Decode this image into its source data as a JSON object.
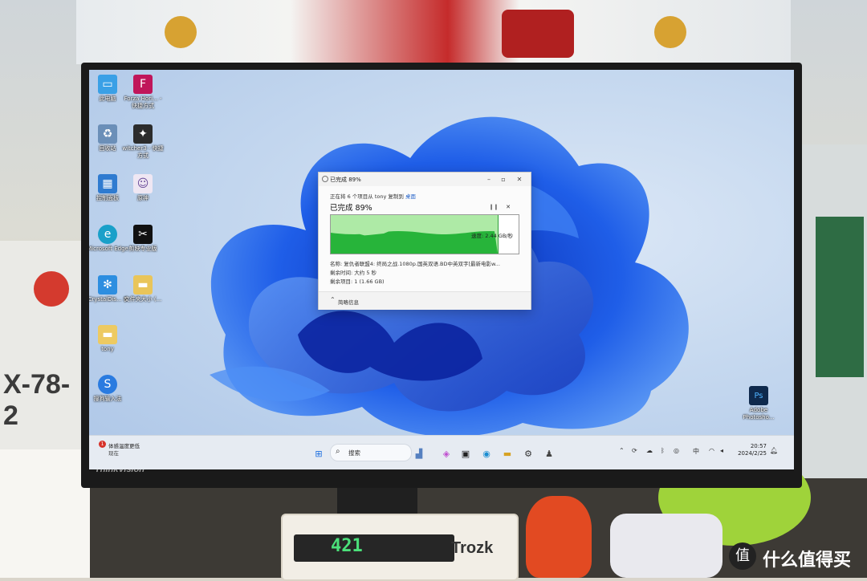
{
  "photo": {
    "gundam_code": "X-78-2",
    "monitor_brand": "ThinkVision",
    "device_brand": "Trozk",
    "device_display": "421",
    "watermark": "值 什么值得买"
  },
  "desktop_icons": [
    {
      "label": "此电脑",
      "icon": "monitor-icon"
    },
    {
      "label": "Forza Hori... - 快捷方式",
      "icon": "forza-icon"
    },
    {
      "label": "回收站",
      "icon": "recycle-bin-icon"
    },
    {
      "label": "witcher3 - 快捷方式",
      "icon": "witcher-icon"
    },
    {
      "label": "控制面板",
      "icon": "control-panel-icon"
    },
    {
      "label": "原神",
      "icon": "genshin-icon"
    },
    {
      "label": "Microsoft Edge",
      "icon": "edge-icon"
    },
    {
      "label": "剪映专业版",
      "icon": "capcut-icon"
    },
    {
      "label": "CrystalDis... 8",
      "icon": "crystaldisk-icon"
    },
    {
      "label": "文件夹大小 (...",
      "icon": "folder-icon"
    },
    {
      "label": "tony",
      "icon": "user-folder-icon"
    },
    {
      "label": "搜狗输入法",
      "icon": "sogou-icon"
    },
    {
      "label": "Adobe Photosho...",
      "icon": "photoshop-icon"
    }
  ],
  "dialog": {
    "title": "已完成 89%",
    "subtitle_prefix": "正在将 6 个项目从 tony 复制到",
    "subtitle_link": "桌面",
    "progress_label": "已完成 89%",
    "progress_fraction": 0.89,
    "speed": "速度: 2.44 GB/秒",
    "name_line": "名称: 复仇者联盟4: 终局之战.1080p.国英双语.BD中英双字[最新电影w...",
    "time_line": "剩余时间: 大约 5 秒",
    "items_line": "剩余项目: 1 (1.66 GB)",
    "details_label": "简略信息",
    "pause_icon": "pause-icon",
    "cancel_icon": "close-icon"
  },
  "taskbar": {
    "weather_badge": "1",
    "weather_line1": "体感温度更低",
    "weather_line2": "现在",
    "search_placeholder": "搜索",
    "ime": "中",
    "time": "20:57",
    "date": "2024/2/25"
  }
}
